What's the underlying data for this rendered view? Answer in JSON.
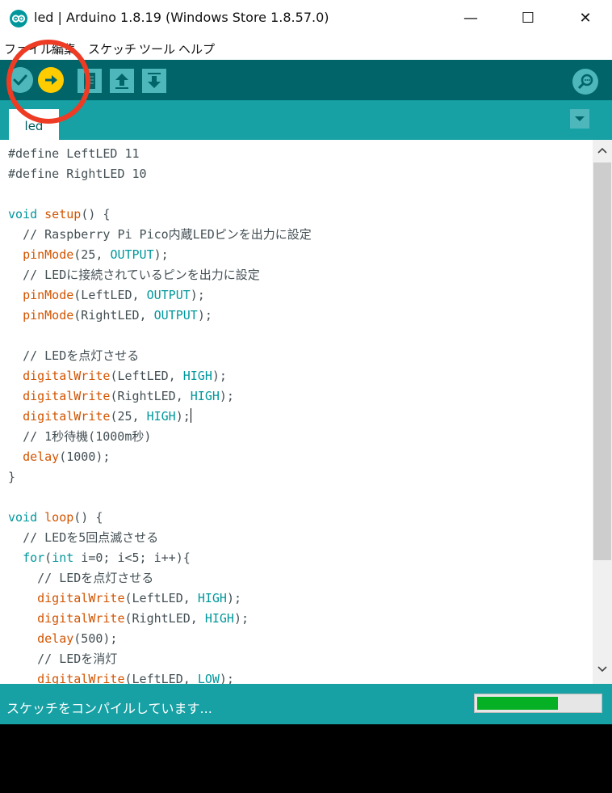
{
  "window": {
    "title": "led | Arduino 1.8.19 (Windows Store 1.8.57.0)",
    "controls": {
      "minimize": "—",
      "maximize": "☐",
      "close": "✕"
    }
  },
  "menu": {
    "items": [
      "ファイル",
      "編集",
      "スケッチ",
      "ツール",
      "ヘルプ"
    ]
  },
  "toolbar": {
    "buttons": [
      {
        "name": "verify",
        "icon": "check-icon"
      },
      {
        "name": "upload",
        "icon": "arrow-right-icon"
      },
      {
        "name": "new",
        "icon": "new-file-icon"
      },
      {
        "name": "open",
        "icon": "arrow-up-icon"
      },
      {
        "name": "save",
        "icon": "arrow-down-icon"
      },
      {
        "name": "serial-monitor",
        "icon": "magnifier-icon"
      }
    ],
    "highlight_color": "#ee3b24"
  },
  "tabs": {
    "active": "led",
    "menu_icon": "triangle-down-icon"
  },
  "editor": {
    "lines": [
      "#define LeftLED 11",
      "#define RightLED 10",
      "",
      "void setup() {",
      "  // Raspberry Pi Pico内蔵LEDピンを出力に設定",
      "  pinMode(25, OUTPUT);",
      "  // LEDに接続されているピンを出力に設定",
      "  pinMode(LeftLED, OUTPUT);",
      "  pinMode(RightLED, OUTPUT);",
      "",
      "  // LEDを点灯させる",
      "  digitalWrite(LeftLED, HIGH);",
      "  digitalWrite(RightLED, HIGH);",
      "  digitalWrite(25, HIGH);",
      "  // 1秒待機(1000m秒)",
      "  delay(1000);",
      "}",
      "",
      "void loop() {",
      "  // LEDを5回点滅させる",
      "  for(int i=0; i<5; i++){",
      "    // LEDを点灯させる",
      "    digitalWrite(LeftLED, HIGH);",
      "    digitalWrite(RightLED, HIGH);",
      "    delay(500);",
      "    // LEDを消灯",
      "    digitalWrite(LeftLED, LOW);"
    ],
    "caret_line": 13
  },
  "status": {
    "message": "スケッチをコンパイルしています...",
    "progress": 0.66
  },
  "colors": {
    "toolbar": "#006468",
    "tabbar": "#17a1a5",
    "upload_button": "#ffcc00",
    "progress_fill": "#06b025",
    "keyword": "#00979c",
    "function": "#d35400"
  }
}
